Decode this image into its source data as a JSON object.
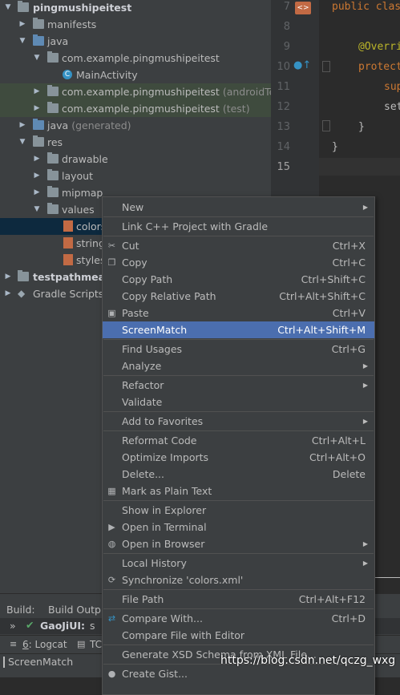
{
  "tree": {
    "root": "pingmushipeitest",
    "manifests": "manifests",
    "java": "java",
    "pkg_main": "com.example.pingmushipeitest",
    "main_activity": "MainActivity",
    "main_activity_icon": "C",
    "pkg_android_test": "com.example.pingmushipeitest",
    "pkg_android_test_suffix": "(androidTest)",
    "pkg_test": "com.example.pingmushipeitest",
    "pkg_test_suffix": "(test)",
    "java_generated": "java",
    "java_generated_suffix": "(generated)",
    "res": "res",
    "drawable": "drawable",
    "layout": "layout",
    "mipmap": "mipmap",
    "values": "values",
    "file_colors": "colors",
    "file_strings": "string",
    "file_styles": "styles",
    "testpathmeasure": "testpathmeasu",
    "gradle_scripts": "Gradle Scripts"
  },
  "editor": {
    "line_numbers": [
      "7",
      "8",
      "9",
      "10",
      "11",
      "12",
      "13",
      "14",
      "15"
    ],
    "line7_kw": "public",
    "line7_rest": "clas",
    "line9": "@Overri",
    "line10": "protect",
    "line11": "sup",
    "line12": "set",
    "line13": "}",
    "line14": "}"
  },
  "bottom": {
    "build_tab": "Build:",
    "build_output": "Build Outpu",
    "run_prefix": "»",
    "run_label": "GaoJiUI:",
    "run_rest": "s",
    "logcat_num": "6",
    "logcat": "Logcat",
    "tc": "TC",
    "status": "ScreenMatch",
    "watermark": "https://blog.csdn.net/qczg_wxg"
  },
  "menu": {
    "new": "New",
    "link_cpp": "Link C++ Project with Gradle",
    "cut": "Cut",
    "cut_sc": "Ctrl+X",
    "copy": "Copy",
    "copy_sc": "Ctrl+C",
    "copy_path": "Copy Path",
    "copy_path_sc": "Ctrl+Shift+C",
    "copy_rel": "Copy Relative Path",
    "copy_rel_sc": "Ctrl+Alt+Shift+C",
    "paste": "Paste",
    "paste_sc": "Ctrl+V",
    "screenmatch": "ScreenMatch",
    "screenmatch_sc": "Ctrl+Alt+Shift+M",
    "find_usages": "Find Usages",
    "find_usages_sc": "Ctrl+G",
    "analyze": "Analyze",
    "refactor": "Refactor",
    "validate": "Validate",
    "add_fav": "Add to Favorites",
    "reformat": "Reformat Code",
    "reformat_sc": "Ctrl+Alt+L",
    "optimize": "Optimize Imports",
    "optimize_sc": "Ctrl+Alt+O",
    "delete": "Delete...",
    "delete_sc": "Delete",
    "mark_plain": "Mark as Plain Text",
    "show_explorer": "Show in Explorer",
    "open_terminal": "Open in Terminal",
    "open_browser": "Open in Browser",
    "local_history": "Local History",
    "synchronize": "Synchronize 'colors.xml'",
    "file_path": "File Path",
    "file_path_sc": "Ctrl+Alt+F12",
    "compare_with": "Compare With...",
    "compare_with_sc": "Ctrl+D",
    "compare_editor": "Compare File with Editor",
    "generate_xsd": "Generate XSD Schema from XML File...",
    "create_gist": "Create Gist..."
  },
  "colors": {
    "menu_highlight": "#4b6eaf",
    "keyword": "#cc7832",
    "annotation": "#bbb529",
    "vcs_green": "#3f4b3e"
  }
}
